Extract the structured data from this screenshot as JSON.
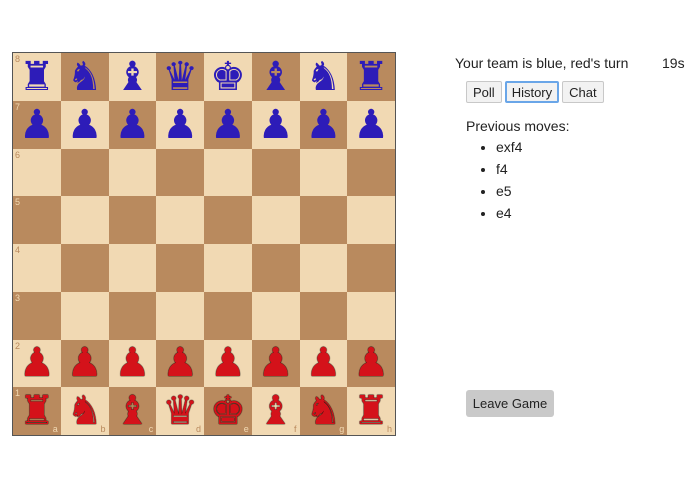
{
  "status_text": "Your team is blue, red's turn",
  "timer": "19s",
  "tabs": [
    {
      "label": "Poll",
      "active": false
    },
    {
      "label": "History",
      "active": true
    },
    {
      "label": "Chat",
      "active": false
    }
  ],
  "history": {
    "title": "Previous moves:",
    "moves": [
      "exf4",
      "f4",
      "e5",
      "e4"
    ]
  },
  "leave_button": "Leave Game",
  "board": {
    "files": [
      "a",
      "b",
      "c",
      "d",
      "e",
      "f",
      "g",
      "h"
    ],
    "ranks": [
      "8",
      "7",
      "6",
      "5",
      "4",
      "3",
      "2",
      "1"
    ],
    "rows": [
      [
        "bR",
        "bN",
        "bB",
        "bQ",
        "bK",
        "bB",
        "bN",
        "bR"
      ],
      [
        "bP",
        "bP",
        "bP",
        "bP",
        "bP",
        "bP",
        "bP",
        "bP"
      ],
      [
        "",
        "",
        "",
        "",
        "",
        "",
        "",
        ""
      ],
      [
        "",
        "",
        "",
        "",
        "",
        "",
        "",
        ""
      ],
      [
        "",
        "",
        "",
        "",
        "",
        "",
        "",
        ""
      ],
      [
        "",
        "",
        "",
        "",
        "",
        "",
        "",
        ""
      ],
      [
        "rP",
        "rP",
        "rP",
        "rP",
        "rP",
        "rP",
        "rP",
        "rP"
      ],
      [
        "rR",
        "rN",
        "rB",
        "rQ",
        "rK",
        "rB",
        "rN",
        "rR"
      ]
    ],
    "colors": {
      "blue_team": "#2d1cb8",
      "red_team": "#d4121a",
      "light_square": "#f1d9b3",
      "dark_square": "#b98a5e"
    }
  }
}
